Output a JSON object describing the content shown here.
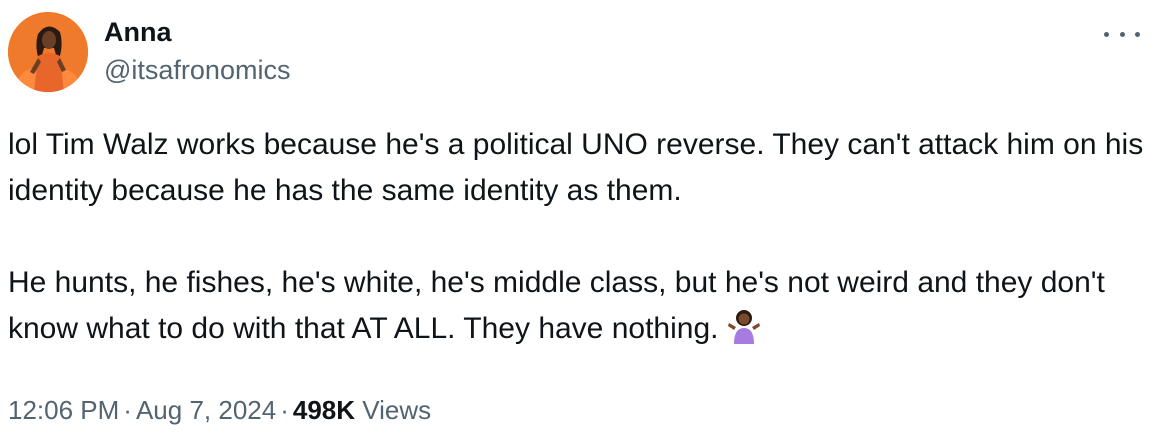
{
  "author": {
    "name": "Anna",
    "handle": "@itsafronomics",
    "avatar_icon": "profile-photo-woman-orange"
  },
  "more_icon": "ellipsis-icon",
  "tweet": {
    "paragraph_1": "lol Tim Walz works because he's a political UNO reverse. They can't attack him on his identity because he has the same identity as them.",
    "paragraph_2": "He hunts, he fishes, he's white, he's middle class, but he's not weird and they don't know what to do with that AT ALL. They have nothing.",
    "emoji": "person-shrugging-emoji"
  },
  "meta": {
    "time": "12:06 PM",
    "separator": "·",
    "date": "Aug 7, 2024",
    "views_count": "498K",
    "views_label": "Views"
  },
  "colors": {
    "text_primary": "#0f1419",
    "text_secondary": "#536471",
    "avatar_bg": "#f07a2c"
  }
}
